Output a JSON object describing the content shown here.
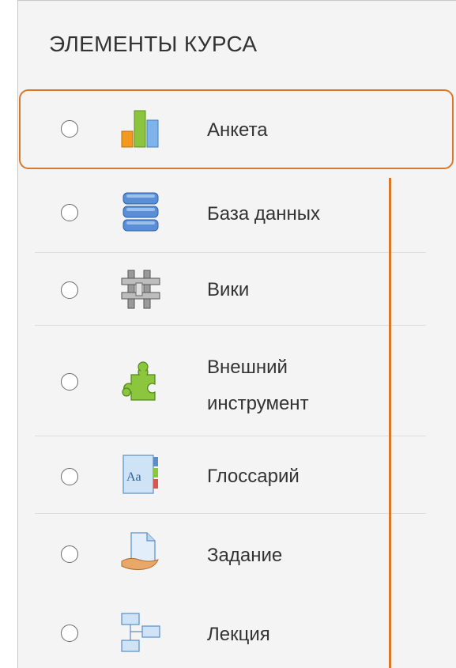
{
  "section": {
    "title": "ЭЛЕМЕНТЫ КУРСА"
  },
  "items": [
    {
      "label": "Анкета",
      "icon": "feedback-bar-chart-icon"
    },
    {
      "label": "База данных",
      "icon": "database-icon"
    },
    {
      "label": "Вики",
      "icon": "wiki-icon"
    },
    {
      "label": "Внешний инструмент",
      "label_line1": "Внешний",
      "label_line2": "инструмент",
      "icon": "external-tool-puzzle-icon"
    },
    {
      "label": "Глоссарий",
      "icon": "glossary-icon"
    },
    {
      "label": "Задание",
      "icon": "assignment-icon"
    },
    {
      "label": "Лекция",
      "icon": "lesson-icon"
    }
  ],
  "colors": {
    "highlight": "#d9772a",
    "panel_background": "#f4f4f4"
  }
}
